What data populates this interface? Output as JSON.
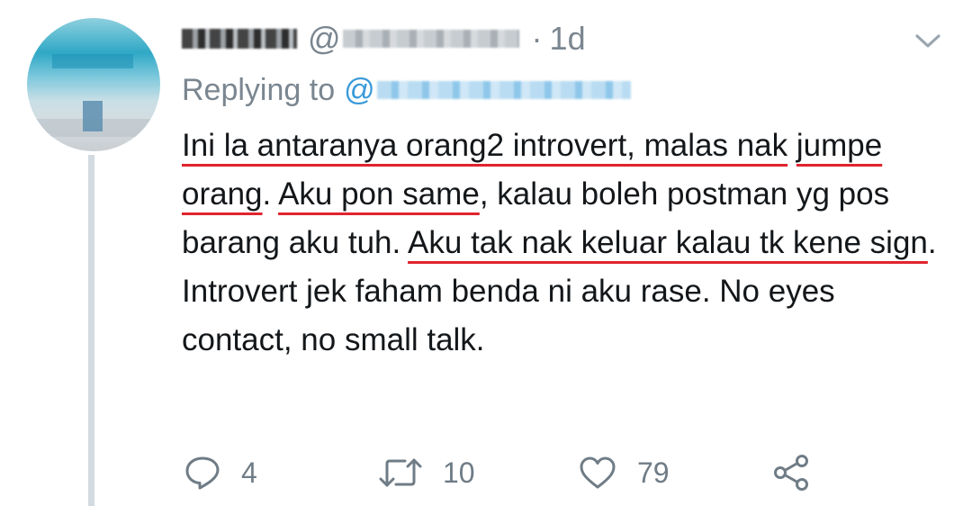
{
  "tweet": {
    "name": "",
    "handle_prefix": "@",
    "separator": "·",
    "time": "1d",
    "replying_prefix": "Replying to",
    "replying_at": "@",
    "body": [
      {
        "text": "Ini la antaranya orang2 introvert, malas nak",
        "underline": true
      },
      {
        "text": " ",
        "underline": false
      },
      {
        "text": "jumpe orang",
        "underline": true
      },
      {
        "text": ". ",
        "underline": false
      },
      {
        "text": "Aku pon same",
        "underline": true
      },
      {
        "text": ", kalau boleh postman yg pos barang aku tuh. ",
        "underline": false
      },
      {
        "text": "Aku tak nak keluar kalau tk kene sign",
        "underline": true
      },
      {
        "text": ". Introvert jek faham benda ni aku rase. No eyes contact, no small talk.",
        "underline": false
      }
    ],
    "underline_color": "#e0242e",
    "text_color": "#14171a",
    "muted_color": "#7a8690",
    "link_color": "#3a9ad9"
  },
  "actions": {
    "reply": {
      "icon": "reply-icon",
      "count": "4"
    },
    "retweet": {
      "icon": "retweet-icon",
      "count": "10"
    },
    "like": {
      "icon": "heart-icon",
      "count": "79"
    },
    "share": {
      "icon": "share-icon"
    }
  },
  "menu": {
    "icon": "chevron-down-icon"
  }
}
